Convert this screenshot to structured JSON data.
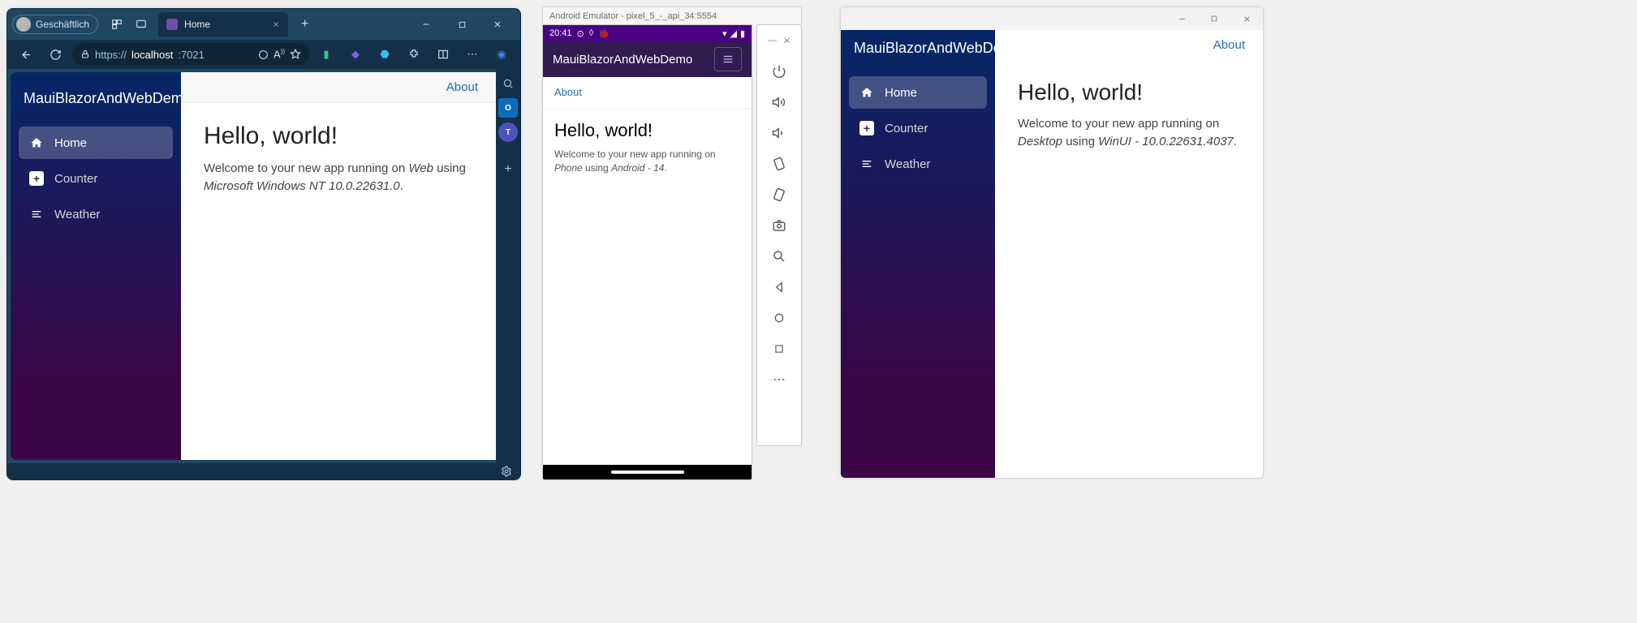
{
  "app": {
    "brand": "MauiBlazorAndWebDemo",
    "about": "About",
    "nav": {
      "home": "Home",
      "counter": "Counter",
      "weather": "Weather"
    },
    "page_title": "Hello, world!",
    "welcome_prefix": "Welcome to your new app running on ",
    "welcome_mid": " using "
  },
  "browser": {
    "profile_label": "Geschäftlich",
    "tab_title": "Home",
    "url_host": "localhost",
    "url_port": ":7021",
    "url_scheme": "https://",
    "platform": "Web",
    "detail": "Microsoft Windows NT 10.0.22631.0",
    "trailing": "."
  },
  "emulator": {
    "window_title": "Android Emulator - pixel_5_-_api_34:5554",
    "clock": "20:41",
    "platform": "Phone",
    "detail": "Android - 14",
    "trailing": "."
  },
  "desktop": {
    "platform": "Desktop",
    "detail": "WinUI - 10.0.22631.4037",
    "trailing": "."
  }
}
